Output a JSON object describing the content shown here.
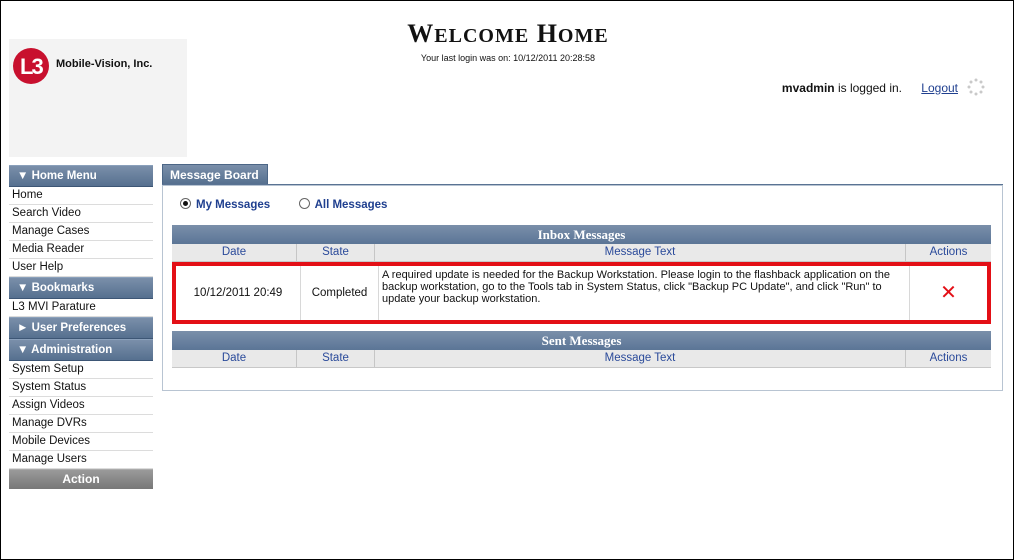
{
  "header": {
    "title_first": "W",
    "title_first_rest": "ELCOME",
    "title_second": "H",
    "title_second_rest": "OME",
    "last_login": "Your last login was on: 10/12/2011 20:28:58",
    "logo_text": "Mobile-Vision, Inc.",
    "logo_mark": "L3",
    "username": "mvadmin",
    "logged_in_text": " is logged in.",
    "logout_label": "Logout"
  },
  "sidebar": {
    "home_menu": {
      "title": "▼  Home Menu",
      "items": [
        "Home",
        "Search Video",
        "Manage Cases",
        "Media Reader",
        "User Help"
      ]
    },
    "bookmarks": {
      "title": "▼  Bookmarks",
      "items": [
        "L3 MVI Parature"
      ]
    },
    "user_prefs": {
      "title": "►  User Preferences"
    },
    "administration": {
      "title": "▼  Administration",
      "items": [
        "System Setup",
        "System Status",
        "Assign Videos",
        "Manage DVRs",
        "Mobile Devices",
        "Manage Users"
      ]
    },
    "action_label": "Action"
  },
  "tab": {
    "label": "Message Board"
  },
  "filters": {
    "my_messages": "My Messages",
    "all_messages": "All Messages",
    "selected": "my_messages"
  },
  "inbox": {
    "title": "Inbox Messages",
    "columns": [
      "Date",
      "State",
      "Message Text",
      "Actions"
    ],
    "rows": [
      {
        "date": "10/12/2011 20:49",
        "state": "Completed",
        "text": "A required update is needed for the Backup Workstation. Please login to the flashback application on the backup workstation, go to the Tools tab in System Status, click \"Backup PC Update\", and click \"Run\" to update your backup workstation.",
        "action": "✕"
      }
    ]
  },
  "sent": {
    "title": "Sent Messages",
    "columns": [
      "Date",
      "State",
      "Message Text",
      "Actions"
    ]
  },
  "colors": {
    "header_blue": "#5b7596",
    "highlight_red": "#e30f16",
    "link_blue": "#1f3f8f"
  }
}
